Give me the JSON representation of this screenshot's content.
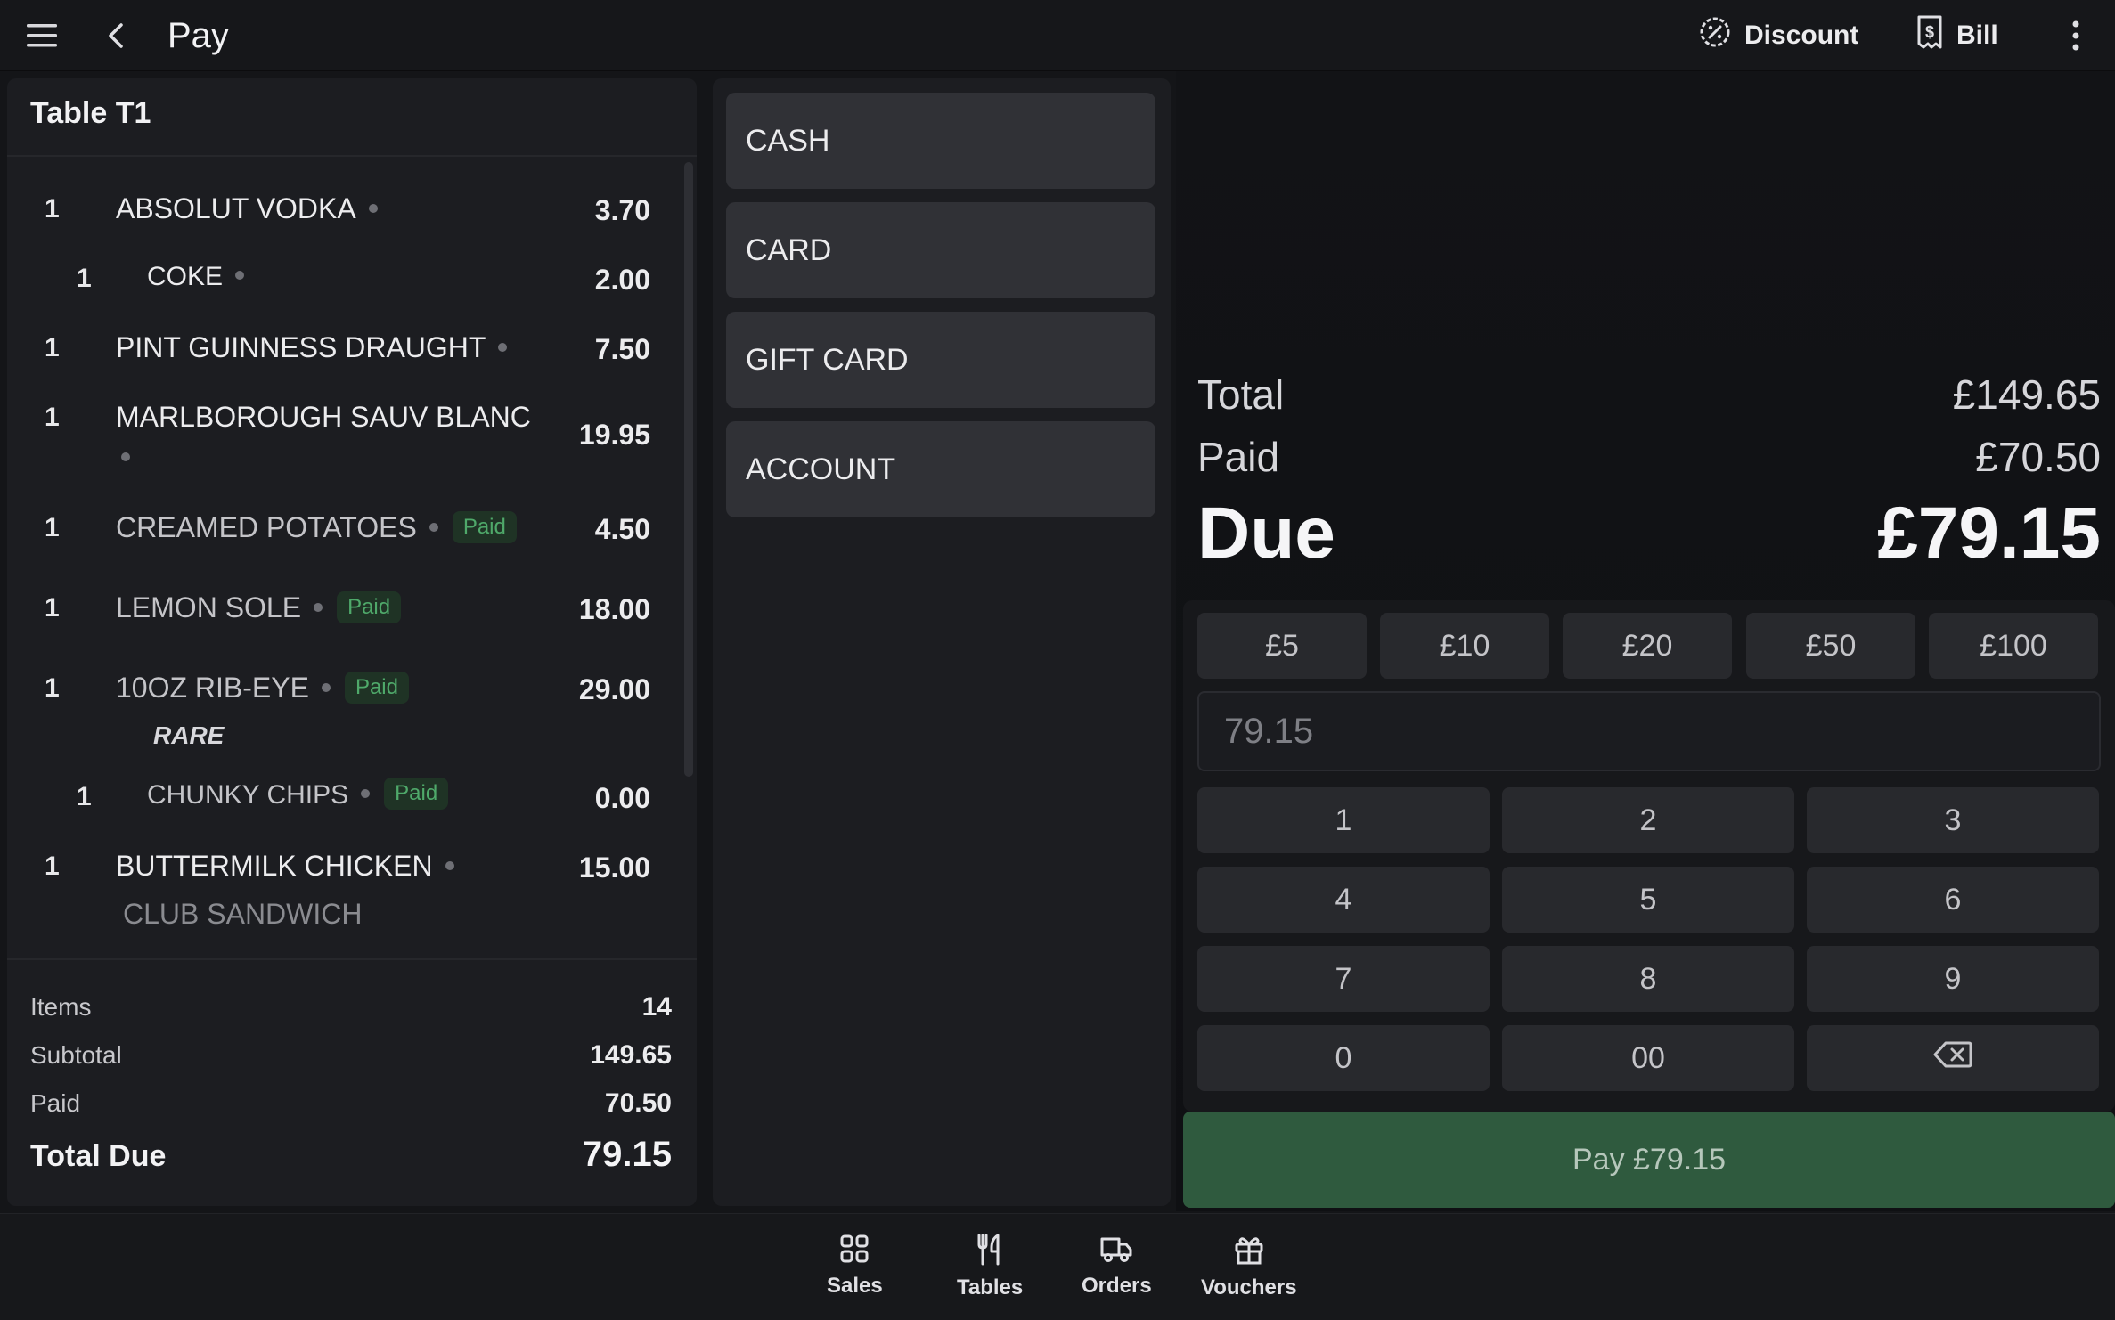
{
  "header": {
    "title": "Pay",
    "discount_label": "Discount",
    "bill_label": "Bill"
  },
  "order": {
    "table_title": "Table T1",
    "items": [
      {
        "qty": "1",
        "name": "ABSOLUT VODKA",
        "price": "3.70"
      },
      {
        "qty": "1",
        "name": "COKE",
        "price": "2.00"
      },
      {
        "qty": "1",
        "name": "PINT GUINNESS DRAUGHT",
        "price": "7.50"
      },
      {
        "qty": "1",
        "name": "MARLBOROUGH SAUV BLANC",
        "price": "19.95"
      },
      {
        "qty": "1",
        "name": "CREAMED POTATOES",
        "price": "4.50",
        "status": "Paid"
      },
      {
        "qty": "1",
        "name": "LEMON SOLE",
        "price": "18.00",
        "status": "Paid"
      },
      {
        "qty": "1",
        "name": "10OZ RIB-EYE",
        "price": "29.00",
        "status": "Paid"
      },
      {
        "note": "RARE"
      },
      {
        "qty": "1",
        "name": "CHUNKY CHIPS",
        "price": "0.00",
        "status": "Paid"
      },
      {
        "qty": "1",
        "name": "BUTTERMILK CHICKEN",
        "price": "15.00"
      },
      {
        "name": "CLUB SANDWICH"
      }
    ],
    "summary": {
      "items_label": "Items",
      "items_value": "14",
      "subtotal_label": "Subtotal",
      "subtotal_value": "149.65",
      "paid_label": "Paid",
      "paid_value": "70.50",
      "total_due_label": "Total Due",
      "total_due_value": "79.15"
    }
  },
  "payment_methods": [
    "CASH",
    "CARD",
    "GIFT CARD",
    "ACCOUNT"
  ],
  "totals": {
    "total_label": "Total",
    "total_value": "£149.65",
    "paid_label": "Paid",
    "paid_value": "£70.50",
    "due_label": "Due",
    "due_value": "£79.15"
  },
  "keypad": {
    "quick_amounts": [
      "£5",
      "£10",
      "£20",
      "£50",
      "£100"
    ],
    "amount_placeholder": "79.15",
    "keys": [
      "1",
      "2",
      "3",
      "4",
      "5",
      "6",
      "7",
      "8",
      "9",
      "0",
      "00"
    ]
  },
  "pay_button_label": "Pay £79.15",
  "nav": {
    "sales": "Sales",
    "tables": "Tables",
    "orders": "Orders",
    "vouchers": "Vouchers"
  },
  "colors": {
    "background": "#141518",
    "panel": "#1c1d21",
    "paid_badge": "#4fa96a",
    "pay_button": "#2f5a3e"
  },
  "icons": {
    "menu": "hamburger-icon",
    "back": "chevron-left-icon",
    "discount": "percent-badge-icon",
    "bill": "receipt-icon",
    "more": "kebab-icon",
    "backspace": "backspace-icon"
  }
}
